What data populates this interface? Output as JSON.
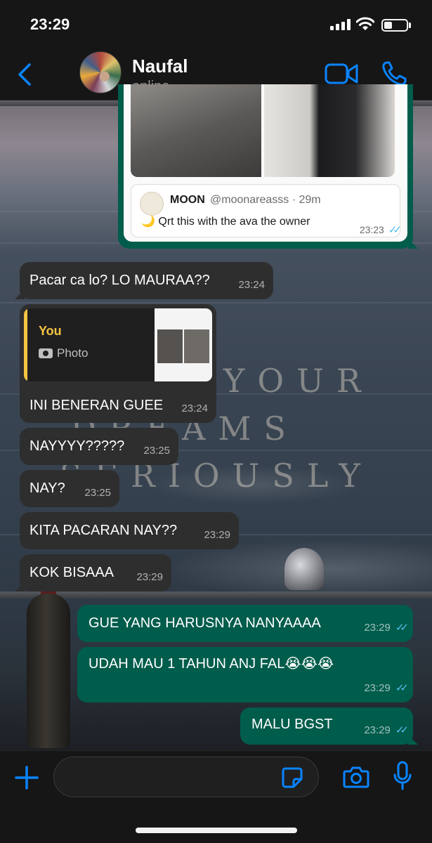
{
  "status_bar": {
    "time": "23:29",
    "battery_level": 0.35
  },
  "header": {
    "contact_name": "Naufal",
    "contact_status": "online"
  },
  "wallpaper_text": [
    "YOUR",
    "DREAMS",
    "SERIOUSLY"
  ],
  "tweet": {
    "quote_name": "MOON",
    "quote_handle": "@moonareasss · 29m",
    "quote_text": "🌙 Qrt this with the ava the owner",
    "time": "23:23"
  },
  "messages": [
    {
      "text": "Pacar ca lo? LO MAURAA??",
      "time": "23:24",
      "dir": "in"
    },
    {
      "reply_sender": "You",
      "reply_type": "Photo",
      "text": "INI BENERAN GUEE",
      "time": "23:24",
      "dir": "in"
    },
    {
      "text": "NAYYYY?????",
      "time": "23:25",
      "dir": "in"
    },
    {
      "text": "NAY?",
      "time": "23:25",
      "dir": "in"
    },
    {
      "text": "KITA PACARAN NAY??",
      "time": "23:29",
      "dir": "in"
    },
    {
      "text": "KOK BISAAA",
      "time": "23:29",
      "dir": "in"
    },
    {
      "text": "GUE YANG HARUSNYA NANYAAAA",
      "time": "23:29",
      "dir": "out"
    },
    {
      "text": "UDAH MAU 1 TAHUN ANJ FAL😭😭😭",
      "time": "23:29",
      "dir": "out"
    },
    {
      "text": "MALU BGST",
      "time": "23:29",
      "dir": "out"
    }
  ],
  "input": {
    "placeholder": ""
  },
  "colors": {
    "accent": "#0a84ff",
    "outgoing_bubble": "#005c4b",
    "incoming_bubble": "#2e2e2f",
    "read_ticks": "#53bdeb"
  }
}
